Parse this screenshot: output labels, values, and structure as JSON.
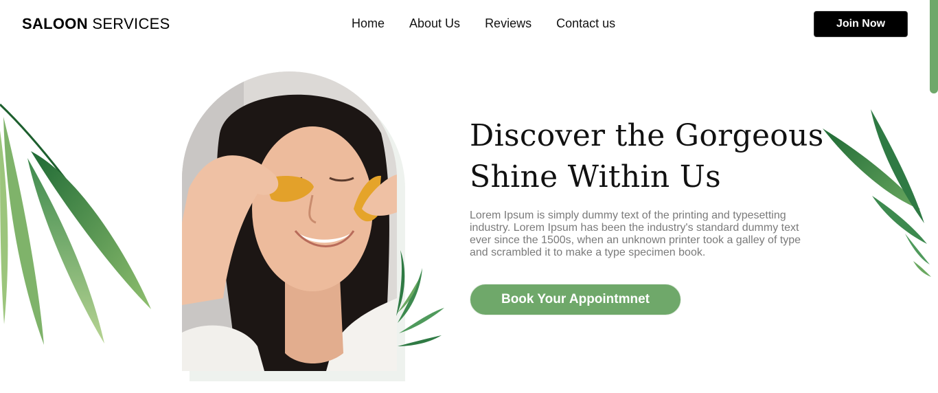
{
  "brand": {
    "bold": "SALOON",
    "light": "SERVICES"
  },
  "nav": {
    "links": [
      "Home",
      "About Us",
      "Reviews",
      "Contact us"
    ],
    "join_label": "Join Now"
  },
  "hero": {
    "title_line1": "Discover the Gorgeous",
    "title_line2": "Shine Within Us",
    "description": "Lorem Ipsum is simply dummy text of the printing and typesetting industry. Lorem Ipsum has been the industry's standard dummy text ever since the 1500s, when an unknown printer took a galley of type and scrambled it to make a type specimen book.",
    "cta_label": "Book Your Appointmnet"
  },
  "colors": {
    "accent": "#6fa86a",
    "leaf_dark": "#2f7a44",
    "leaf_light": "#a6c98a",
    "button_dark": "#000000"
  },
  "icons": [
    "palm-leaf-left-decoration",
    "palm-leaf-right-decoration",
    "palm-leaf-small-decoration",
    "portrait-photo"
  ]
}
